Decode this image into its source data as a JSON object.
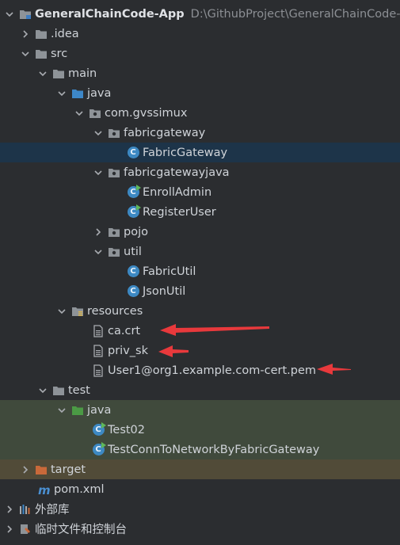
{
  "tree": {
    "project": {
      "name": "GeneralChainCode-App",
      "path": "D:\\GithubProject\\GeneralChainCode-A"
    },
    "idea": ".idea",
    "src": "src",
    "main": "main",
    "java": "java",
    "package_root": "com.gvssimux",
    "fabricgateway": "fabricgateway",
    "fabric_gateway_class": "FabricGateway",
    "fabricgatewayjava": "fabricgatewayjava",
    "enroll_admin": "EnrollAdmin",
    "register_user": "RegisterUser",
    "pojo": "pojo",
    "util": "util",
    "fabric_util": "FabricUtil",
    "json_util": "JsonUtil",
    "resources": "resources",
    "ca_crt": "ca.crt",
    "priv_sk": "priv_sk",
    "user_cert": "User1@org1.example.com-cert.pem",
    "test": "test",
    "test_java": "java",
    "test02": "Test02",
    "test_conn": "TestConnToNetworkByFabricGateway",
    "target": "target",
    "pom": "pom.xml",
    "external_libs": "外部库",
    "scratches": "临时文件和控制台"
  },
  "colors": {
    "selected_row": "#1d3449",
    "test_row": "#404a3c",
    "excluded_row": "#514b38",
    "arrow": "#e8393c"
  }
}
